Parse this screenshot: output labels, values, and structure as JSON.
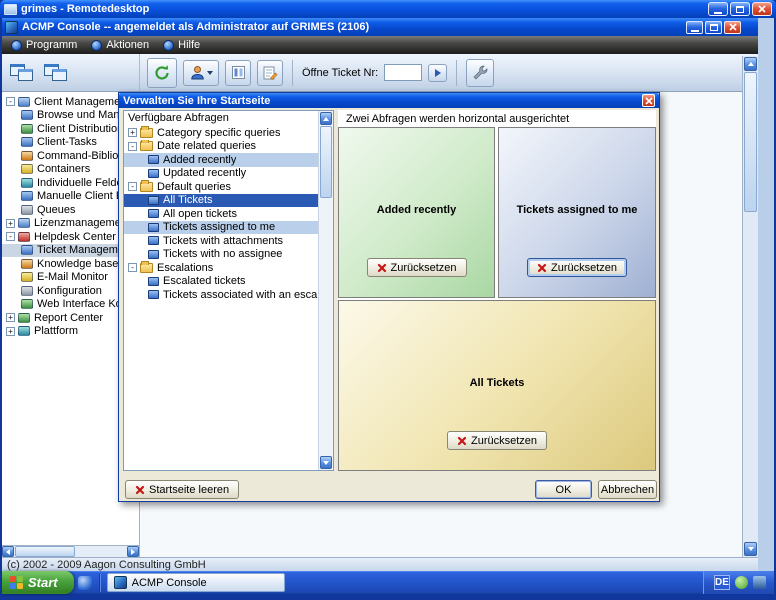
{
  "rdp": {
    "title": "grimes - Remotedesktop"
  },
  "app": {
    "title": "ACMP Console -- angemeldet als Administrator auf GRIMES (2106)"
  },
  "menu": {
    "items": [
      "Programm",
      "Aktionen",
      "Hilfe"
    ]
  },
  "toolbar": {
    "ticket_label": "Öffne Ticket Nr:",
    "ticket_value": ""
  },
  "sidebar": {
    "items": [
      "Client Management C",
      "Browse und Mana",
      "Client Distribution",
      "Client-Tasks",
      "Command-Bibliothek",
      "Containers",
      "Individuelle Felder",
      "Manuelle Client E",
      "Queues",
      "Lizenzmanagement C",
      "Helpdesk Center",
      "Ticket Management",
      "Knowledge base",
      "E-Mail Monitor",
      "Konfiguration",
      "Web Interface Ko",
      "Report Center",
      "Plattform"
    ]
  },
  "dialog": {
    "title": "Verwalten Sie Ihre Startseite",
    "tree_header": "Verfügbare Abfragen",
    "tree": [
      "Category specific queries",
      "Date related queries",
      "Added recently",
      "Updated recently",
      "Default queries",
      "All Tickets",
      "All open tickets",
      "Tickets assigned to me",
      "Tickets with attachments",
      "Tickets with no assignee",
      "Escalations",
      "Escalated tickets",
      "Tickets associated with an escalation"
    ],
    "caption": "Zwei Abfragen werden horizontal ausgerichtet",
    "panels": [
      {
        "title": "Added recently",
        "button": "Zurücksetzen"
      },
      {
        "title": "Tickets assigned to me",
        "button": "Zurücksetzen"
      },
      {
        "title": "All Tickets",
        "button": "Zurücksetzen"
      }
    ],
    "clear": "Startseite leeren",
    "ok": "OK",
    "cancel": "Abbrechen"
  },
  "status": {
    "copyright": "(c) 2002 - 2009 Aagon Consulting GmbH"
  },
  "taskbar": {
    "start_label": "Start",
    "task_label": "ACMP Console",
    "language": "DE"
  },
  "colors": {
    "titlebar": "#0748cc",
    "selection": "#2a5ab4",
    "selection_light": "#bad0ea",
    "taskbar": "#2456cc"
  }
}
